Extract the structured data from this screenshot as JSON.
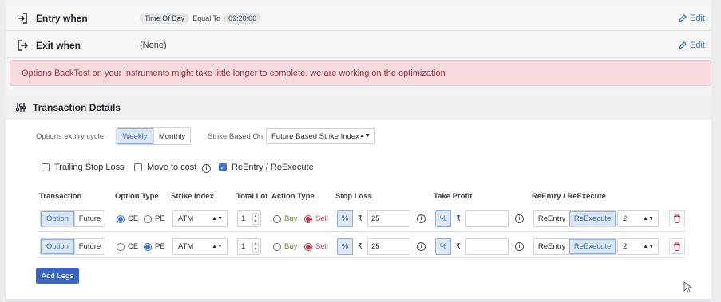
{
  "entry": {
    "title": "Entry when",
    "condition": {
      "field": "Time Of Day",
      "operator": "Equal To",
      "value": "09:20:00"
    },
    "edit_label": "Edit"
  },
  "exit": {
    "title": "Exit when",
    "value": "(None)",
    "edit_label": "Edit"
  },
  "alert": {
    "message": "Options BackTest on your instruments might take little longer to complete. we are working on the optimization"
  },
  "transaction": {
    "title": "Transaction Details",
    "expiry_label": "Options expiry cycle",
    "expiry_options": [
      "Weekly",
      "Monthly"
    ],
    "expiry_selected": "Weekly",
    "strike_based_label": "Strike Based On",
    "strike_based_value": "Future Based Strike Index",
    "checks": [
      {
        "label": "Trailing Stop Loss",
        "checked": false
      },
      {
        "label": "Move to cost",
        "checked": false
      },
      {
        "label": "ReEntry / ReExecute",
        "checked": true
      }
    ],
    "columns": [
      "Transaction",
      "Option Type",
      "Strike Index",
      "Total Lot",
      "Action Type",
      "Stop Loss",
      "Take Profit",
      "ReEntry / ReExecute"
    ],
    "legs": [
      {
        "transaction": [
          "Option",
          "Future"
        ],
        "transaction_selected": "Option",
        "option_type": [
          "CE",
          "PE"
        ],
        "option_selected": "CE",
        "strike": "ATM",
        "lot": "1",
        "action": [
          "Buy",
          "Sell"
        ],
        "action_selected": "Sell",
        "sl_mode": "%",
        "sl_currency": "₹",
        "sl_value": "25",
        "tp_mode": "%",
        "tp_currency": "₹",
        "tp_value": "",
        "reentry": [
          "ReEntry",
          "ReExecute"
        ],
        "reentry_selected": "ReExecute",
        "reentry_count": "2"
      },
      {
        "transaction": [
          "Option",
          "Future"
        ],
        "transaction_selected": "Option",
        "option_type": [
          "CE",
          "PE"
        ],
        "option_selected": "PE",
        "strike": "ATM",
        "lot": "1",
        "action": [
          "Buy",
          "Sell"
        ],
        "action_selected": "Sell",
        "sl_mode": "%",
        "sl_currency": "₹",
        "sl_value": "25",
        "tp_mode": "%",
        "tp_currency": "₹",
        "tp_value": "",
        "reentry": [
          "ReEntry",
          "ReExecute"
        ],
        "reentry_selected": "ReExecute",
        "reentry_count": "2"
      }
    ],
    "add_legs_label": "Add Legs"
  },
  "icons": {
    "entry": "login-arrow-icon",
    "exit": "logout-arrow-icon",
    "edit": "pencil-icon",
    "transaction": "sliders-icon",
    "info": "info-circle-icon",
    "delete": "trash-icon"
  },
  "colors": {
    "accent": "#3865c4",
    "alert_bg": "#f6dade",
    "alert_text": "#9a3040",
    "sell": "#c2384d",
    "buy": "#5a8a2a"
  }
}
